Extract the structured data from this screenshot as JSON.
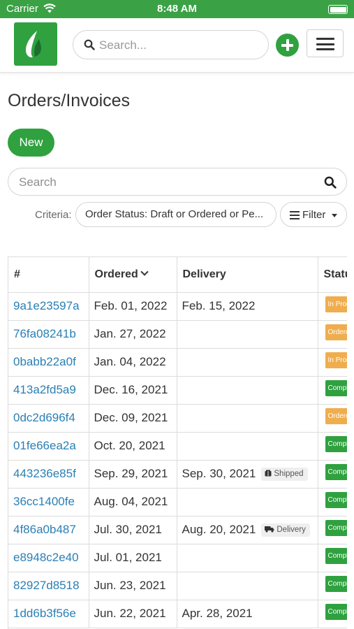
{
  "status_bar": {
    "carrier": "Carrier",
    "time": "8:48 AM"
  },
  "nav": {
    "search_placeholder": "Search..."
  },
  "page": {
    "title": "Orders/Invoices",
    "new_button": "New",
    "search_placeholder": "Search",
    "criteria_label": "Criteria:",
    "criteria_value": "Order Status: Draft or Ordered or Pe...",
    "filter_button": "Filter"
  },
  "table": {
    "headers": [
      "#",
      "Ordered",
      "Delivery",
      "Status"
    ],
    "rows": [
      {
        "id": "9a1e23597a",
        "ordered": "Feb. 01, 2022",
        "delivery": "Feb. 15, 2022",
        "tag": "",
        "status": "In Progress",
        "status_color": "#f0ad4e"
      },
      {
        "id": "76fa08241b",
        "ordered": "Jan. 27, 2022",
        "delivery": "",
        "tag": "",
        "status": "Ordered",
        "status_color": "#f0ad4e"
      },
      {
        "id": "0babb22a0f",
        "ordered": "Jan. 04, 2022",
        "delivery": "",
        "tag": "",
        "status": "In Progress",
        "status_color": "#f0ad4e"
      },
      {
        "id": "413a2fd5a9",
        "ordered": "Dec. 16, 2021",
        "delivery": "",
        "tag": "",
        "status": "Completed",
        "status_color": "#2fa13f"
      },
      {
        "id": "0dc2d696f4",
        "ordered": "Dec. 09, 2021",
        "delivery": "",
        "tag": "",
        "status": "Ordered",
        "status_color": "#f0ad4e"
      },
      {
        "id": "01fe66ea2a",
        "ordered": "Oct. 20, 2021",
        "delivery": "",
        "tag": "",
        "status": "Completed",
        "status_color": "#2fa13f"
      },
      {
        "id": "443236e85f",
        "ordered": "Sep. 29, 2021",
        "delivery": "Sep. 30, 2021",
        "tag": "Shipped",
        "status": "Completed",
        "status_color": "#2fa13f"
      },
      {
        "id": "36cc1400fe",
        "ordered": "Aug. 04, 2021",
        "delivery": "",
        "tag": "",
        "status": "Completed",
        "status_color": "#2fa13f"
      },
      {
        "id": "4f86a0b487",
        "ordered": "Jul. 30, 2021",
        "delivery": "Aug. 20, 2021",
        "tag": "Delivery",
        "status": "Completed",
        "status_color": "#2fa13f"
      },
      {
        "id": "e8948c2e40",
        "ordered": "Jul. 01, 2021",
        "delivery": "",
        "tag": "",
        "status": "Completed",
        "status_color": "#2fa13f"
      },
      {
        "id": "82927d8518",
        "ordered": "Jun. 23, 2021",
        "delivery": "",
        "tag": "",
        "status": "Completed",
        "status_color": "#2fa13f"
      },
      {
        "id": "1dd6b3f56e",
        "ordered": "Jun. 22, 2021",
        "delivery": "Apr. 28, 2021",
        "tag": "",
        "status": "Completed",
        "status_color": "#2fa13f"
      }
    ]
  },
  "colors": {
    "brand_green": "#2fa13f",
    "link_blue": "#2a7fb5",
    "warning_orange": "#f0ad4e"
  },
  "icons": [
    "wifi-icon",
    "battery-icon",
    "app-logo",
    "search-icon",
    "plus-icon",
    "hamburger-menu-icon",
    "filter-icon",
    "caret-down-icon",
    "sort-chevron-icon",
    "package-icon",
    "truck-icon"
  ]
}
